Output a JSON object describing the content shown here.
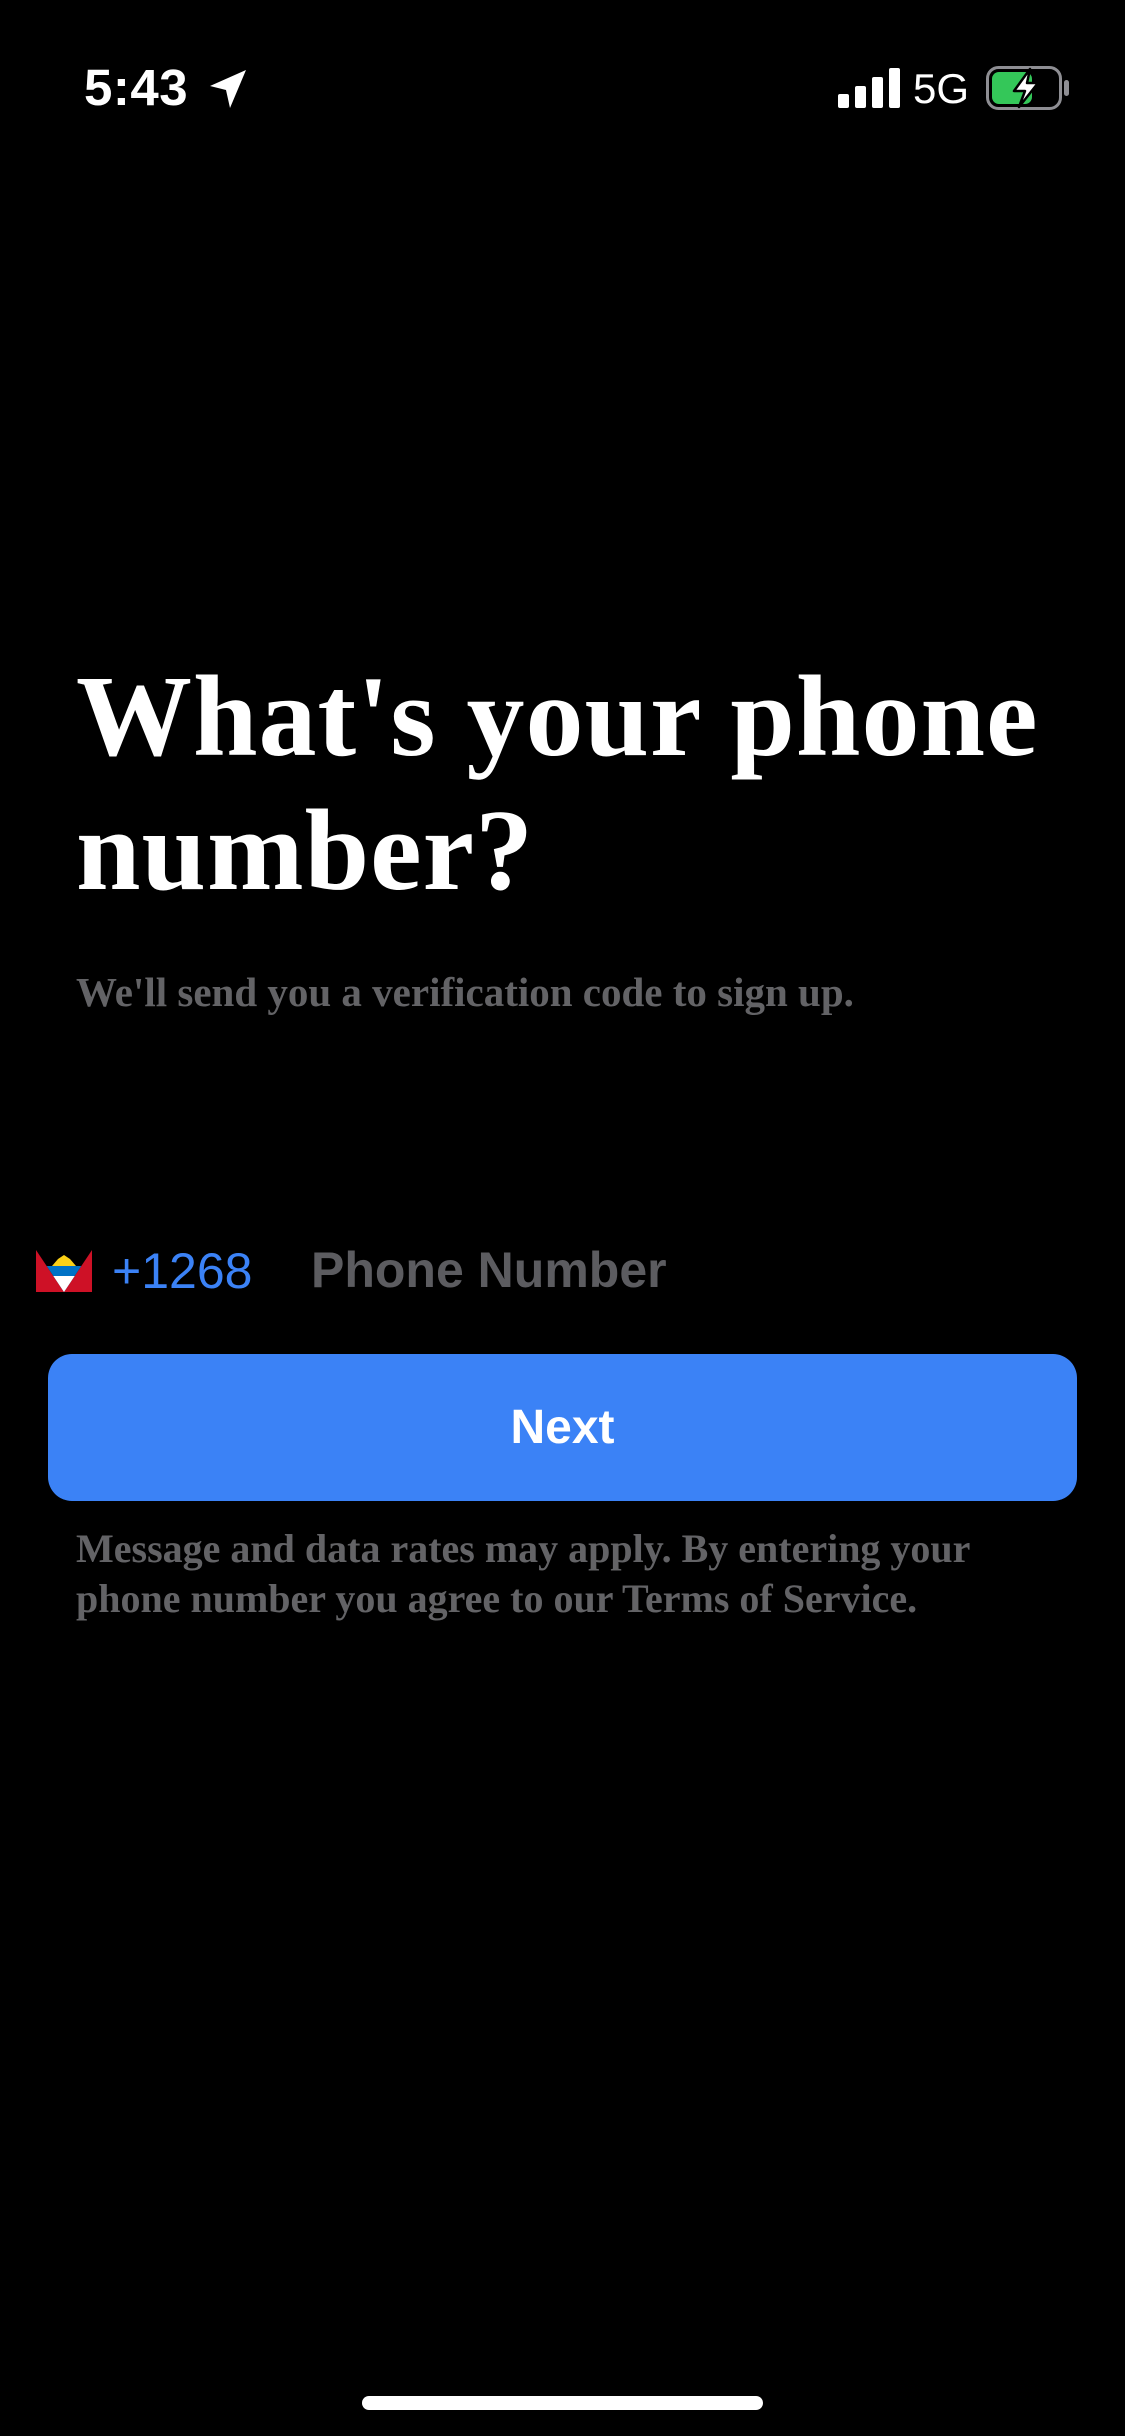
{
  "status_bar": {
    "time": "5:43",
    "network": "5G",
    "icons": {
      "location": "location-arrow-icon",
      "signal": "cellular-signal-icon",
      "battery": "battery-charging-icon"
    },
    "battery_color": "#34c759"
  },
  "main": {
    "title": "What's your phone number?",
    "subtitle": "We'll send you a verification code to sign up."
  },
  "phone_entry": {
    "flag_icon": "antigua-barbuda-flag-icon",
    "country_code": "+1268",
    "placeholder": "Phone Number",
    "value": ""
  },
  "next_button": {
    "label": "Next",
    "color": "#3b82f6"
  },
  "disclaimer": "Message and data rates may apply. By entering your phone number you agree to our Terms of Service.",
  "colors": {
    "background": "#000000",
    "accent": "#3b82f6",
    "muted_text": "#636366"
  }
}
